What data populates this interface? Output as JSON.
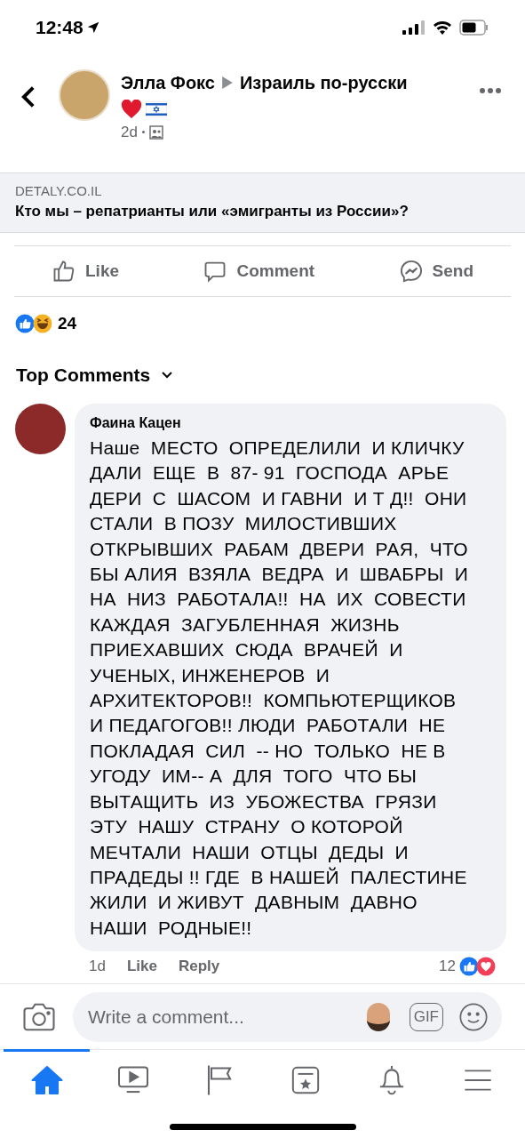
{
  "status_bar": {
    "time": "12:48"
  },
  "post": {
    "author": "Элла Фокс",
    "group": "Израиль по-русски",
    "time": "2d"
  },
  "link": {
    "domain": "DETALY.CO.IL",
    "title": "Кто мы – репатрианты или «эмигранты из России»?"
  },
  "actions": [
    {
      "kind": "like",
      "label": "Like"
    },
    {
      "kind": "comment",
      "label": "Comment"
    },
    {
      "kind": "send",
      "label": "Send"
    }
  ],
  "reactions": {
    "count": "24"
  },
  "comments_header": {
    "label": "Top Comments"
  },
  "comment": {
    "author": "Фаина Кацен",
    "text": "Наше  МЕСТО  ОПРЕДЕЛИЛИ  И КЛИЧКУ\nДАЛИ  ЕЩЕ  В  87- 91  ГОСПОДА  АРЬЕ\nДЕРИ  С  ШАСОМ  И ГАВНИ  И Т Д!!  ОНИ\nСТАЛИ  В ПОЗУ  МИЛОСТИВШИХ\nОТКРЫВШИХ  РАБАМ  ДВЕРИ  РАЯ,  ЧТО\nБЫ АЛИЯ  ВЗЯЛА  ВЕДРА  И  ШВАБРЫ  И\nНА  НИЗ  РАБОТАЛА!!  НА  ИХ  СОВЕСТИ\nКАЖДАЯ  ЗАГУБЛЕННАЯ  ЖИЗНЬ\nПРИЕХАВШИХ  СЮДА  ВРАЧЕЙ  И\nУЧЕНЫХ, ИНЖЕНЕРОВ  И\nАРХИТЕКТОРОВ!!  КОМПЬЮТЕРЩИКОВ\nИ ПЕДАГОГОВ!! ЛЮДИ  РАБОТАЛИ  НЕ\nПОКЛАДАЯ  СИЛ  -- НО  ТОЛЬКО  НЕ В\nУГОДУ  ИМ-- А  ДЛЯ  ТОГО  ЧТО БЫ\nВЫТАЩИТЬ  ИЗ  УБОЖЕСТВА  ГРЯЗИ\nЭТУ  НАШУ  СТРАНУ  О КОТОРОЙ\nМЕЧТАЛИ  НАШИ  ОТЦЫ  ДЕДЫ  И\nПРАДЕДЫ !! ГДЕ  В НАШЕЙ  ПАЛЕСТИНЕ\nЖИЛИ  И ЖИВУТ  ДАВНЫМ  ДАВНО\nНАШИ  РОДНЫЕ!!",
    "time": "1d",
    "like": "Like",
    "reply": "Reply",
    "reaction_count": "12"
  },
  "composer": {
    "placeholder": "Write a comment..."
  },
  "gif": "GIF",
  "tabs": [
    {
      "kind": "home",
      "selected": true
    },
    {
      "kind": "video",
      "selected": false
    },
    {
      "kind": "pages",
      "selected": false
    },
    {
      "kind": "favorites",
      "selected": false
    },
    {
      "kind": "notifications",
      "selected": false
    },
    {
      "kind": "menu",
      "selected": false
    }
  ]
}
